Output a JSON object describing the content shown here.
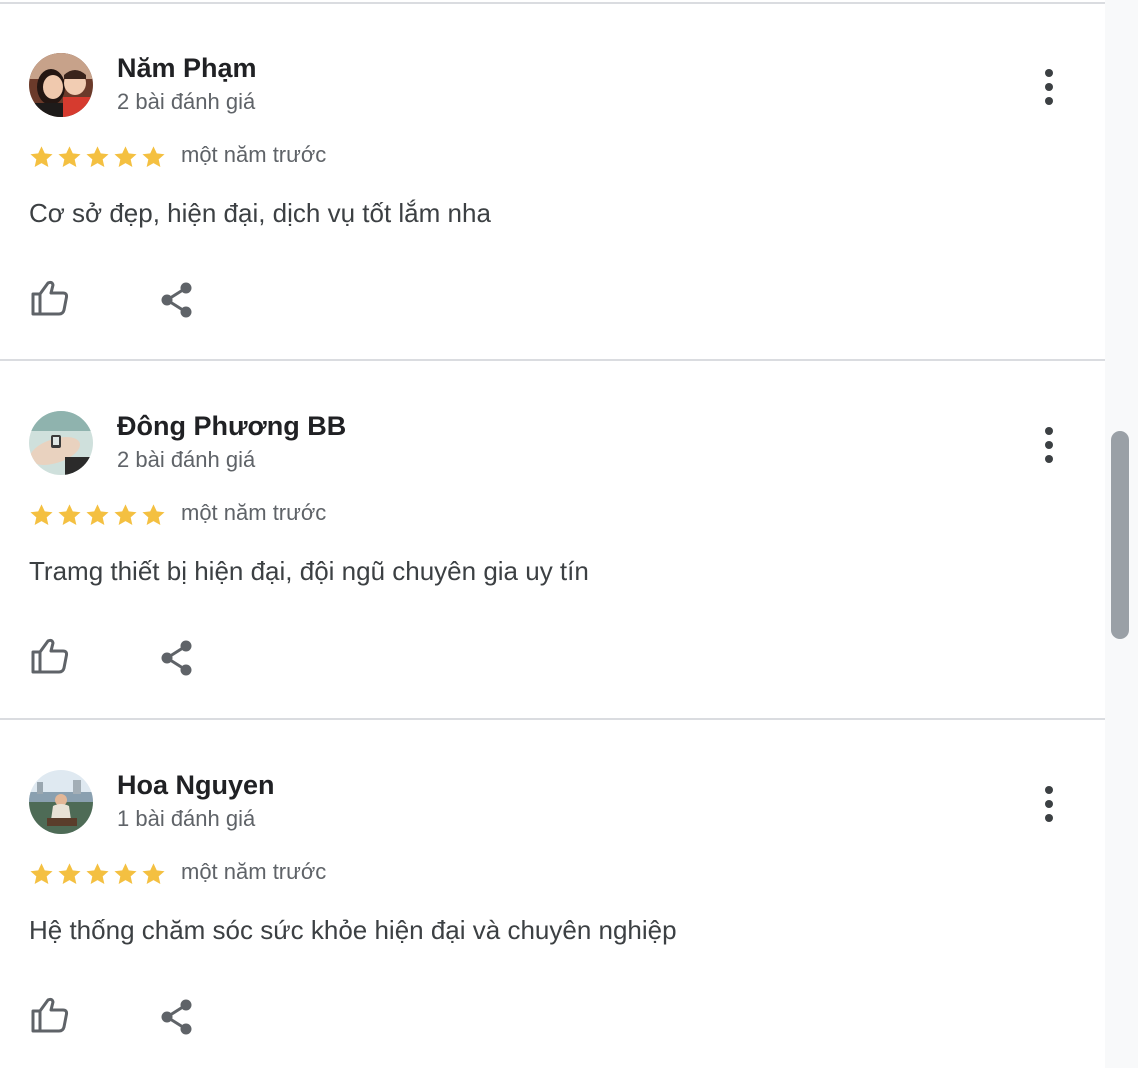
{
  "reviews": [
    {
      "author": "Năm Phạm",
      "review_count": "2 bài đánh giá",
      "rating": 5,
      "time": "một năm trước",
      "text": "Cơ sở đẹp, hiện đại, dịch vụ tốt lắm nha"
    },
    {
      "author": "Đông Phương BB",
      "review_count": "2 bài đánh giá",
      "rating": 5,
      "time": "một năm trước",
      "text": "Tramg thiết bị hiện đại, đội ngũ chuyên gia uy tín"
    },
    {
      "author": "Hoa Nguyen",
      "review_count": "1 bài đánh giá",
      "rating": 5,
      "time": "một năm trước",
      "text": "Hệ thống chăm sóc sức khỏe hiện đại và chuyên nghiệp"
    }
  ],
  "colors": {
    "star": "#f4c041",
    "icon": "#5f6368",
    "divider": "#dadce0"
  },
  "icons": {
    "like": "thumbs-up-icon",
    "share": "share-icon",
    "more": "more-vert-icon",
    "star": "star-icon"
  }
}
